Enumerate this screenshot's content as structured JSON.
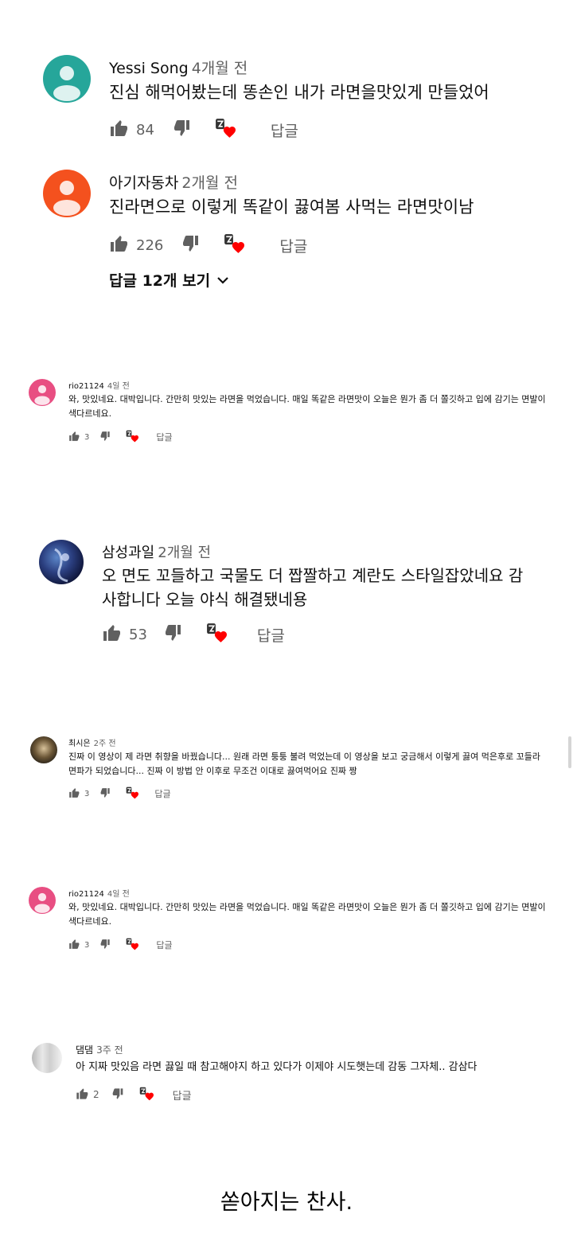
{
  "colors": {
    "avatar_teal": "#26a69a",
    "avatar_orange": "#f4511e",
    "avatar_pink": "#e84e82",
    "heart": "#ff0000",
    "icon": "#606060"
  },
  "icons": {
    "like": "thumbs-up-icon",
    "dislike": "thumbs-down-icon",
    "creator_heart": "creator-heart-icon",
    "expand": "chevron-down-icon"
  },
  "comments": [
    {
      "author": "Yessi Song",
      "time": "4개월 전",
      "text": "진심 해먹어봤는데 똥손인 내가 라면을맛있게 만들었어",
      "likes": "84",
      "reply": "답글"
    },
    {
      "author": "아기자동차",
      "time": "2개월 전",
      "text": "진라면으로 이렇게 똑같이 끓여봄 사먹는 라면맛이남",
      "likes": "226",
      "reply": "답글",
      "replies_label": "답글 12개 보기"
    },
    {
      "author": "rio21124",
      "time": "4일 전",
      "text": "와, 맛있네요. 대박입니다. 간만히 맛있는 라면을 먹었습니다. 매일 똑같은 라면맛이 오늘은 뭔가 좀 더 쫄깃하고 입에 감기는 면발이 색다르네요.",
      "likes": "3",
      "reply": "답글"
    },
    {
      "author": "삼성과일",
      "time": "2개월 전",
      "text": "오 면도 꼬들하고 국물도 더 짭짤하고 계란도 스타일잡았네요 감사합니다 오늘 야식 해결됐네용",
      "likes": "53",
      "reply": "답글"
    },
    {
      "author": "최시은",
      "time": "2주 전",
      "text": "진짜 이 영상이 제 라면 취향을 바꿨습니다... 원래 라면 퉁퉁 불려 먹었는데 이 영상을 보고 궁금해서 이렇게 끓여 먹은후로 꼬들라면파가 되었습니다... 진짜 이 방법 안 이후로 무조건 이대로 끓여먹어요 진짜 짱",
      "likes": "3",
      "reply": "답글"
    },
    {
      "author": "rio21124",
      "time": "4일 전",
      "text": "와, 맛있네요. 대박입니다. 간만히 맛있는 라면을 먹었습니다. 매일 똑같은 라면맛이 오늘은 뭔가 좀 더 쫄깃하고 입에 감기는 면발이 색다르네요.",
      "likes": "3",
      "reply": "답글"
    },
    {
      "author": "댐댐",
      "time": "3주 전",
      "text": "아 지짜 맛있음 라면 끓일 때 참고해야지 하고 있다가 이제야 시도햇는데 감동 그자체.. 감삼다",
      "likes": "2",
      "reply": "답글"
    }
  ],
  "caption": "쏟아지는 찬사."
}
